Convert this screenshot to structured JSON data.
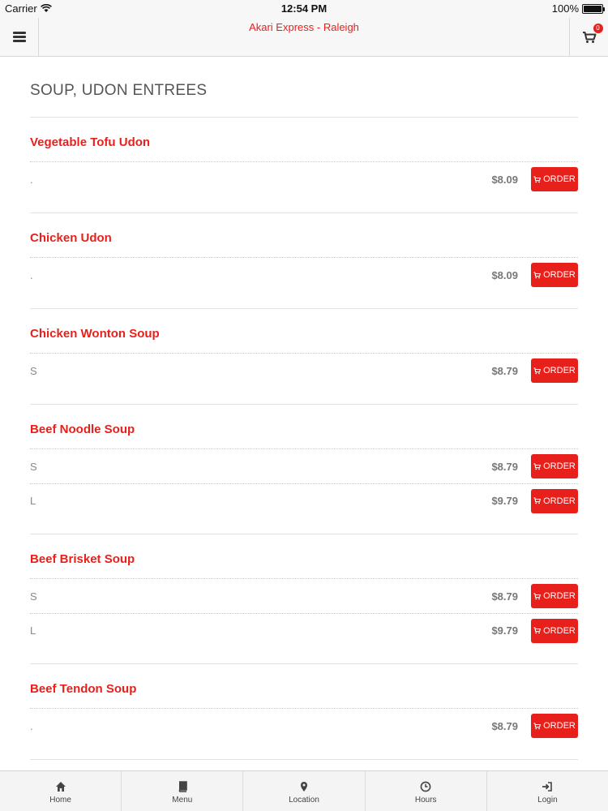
{
  "status_bar": {
    "carrier": "Carrier",
    "time": "12:54 PM",
    "battery": "100%",
    "battery_level": 1.0
  },
  "nav": {
    "title": "Akari Express - Raleigh",
    "cart_count": "0",
    "menu_icon": "hamburger-icon",
    "cart_icon": "cart-icon"
  },
  "section": {
    "title": "SOUP, UDON ENTREES"
  },
  "order_label": "ORDER",
  "accent_color": "#e8201c",
  "items": [
    {
      "name": "Vegetable Tofu Udon",
      "rows": [
        {
          "size": ".",
          "price": "$8.09"
        }
      ]
    },
    {
      "name": "Chicken Udon",
      "rows": [
        {
          "size": ".",
          "price": "$8.09"
        }
      ]
    },
    {
      "name": "Chicken Wonton Soup",
      "rows": [
        {
          "size": "S",
          "price": "$8.79"
        }
      ]
    },
    {
      "name": "Beef Noodle Soup",
      "rows": [
        {
          "size": "S",
          "price": "$8.79"
        },
        {
          "size": "L",
          "price": "$9.79"
        }
      ]
    },
    {
      "name": "Beef Brisket Soup",
      "rows": [
        {
          "size": "S",
          "price": "$8.79"
        },
        {
          "size": "L",
          "price": "$9.79"
        }
      ]
    },
    {
      "name": "Beef Tendon Soup",
      "rows": [
        {
          "size": ".",
          "price": "$8.79"
        }
      ]
    }
  ],
  "tabs": [
    {
      "label": "Home",
      "icon": "home-icon"
    },
    {
      "label": "Menu",
      "icon": "book-icon"
    },
    {
      "label": "Location",
      "icon": "map-pin-icon"
    },
    {
      "label": "Hours",
      "icon": "clock-icon"
    },
    {
      "label": "Login",
      "icon": "login-icon"
    }
  ]
}
